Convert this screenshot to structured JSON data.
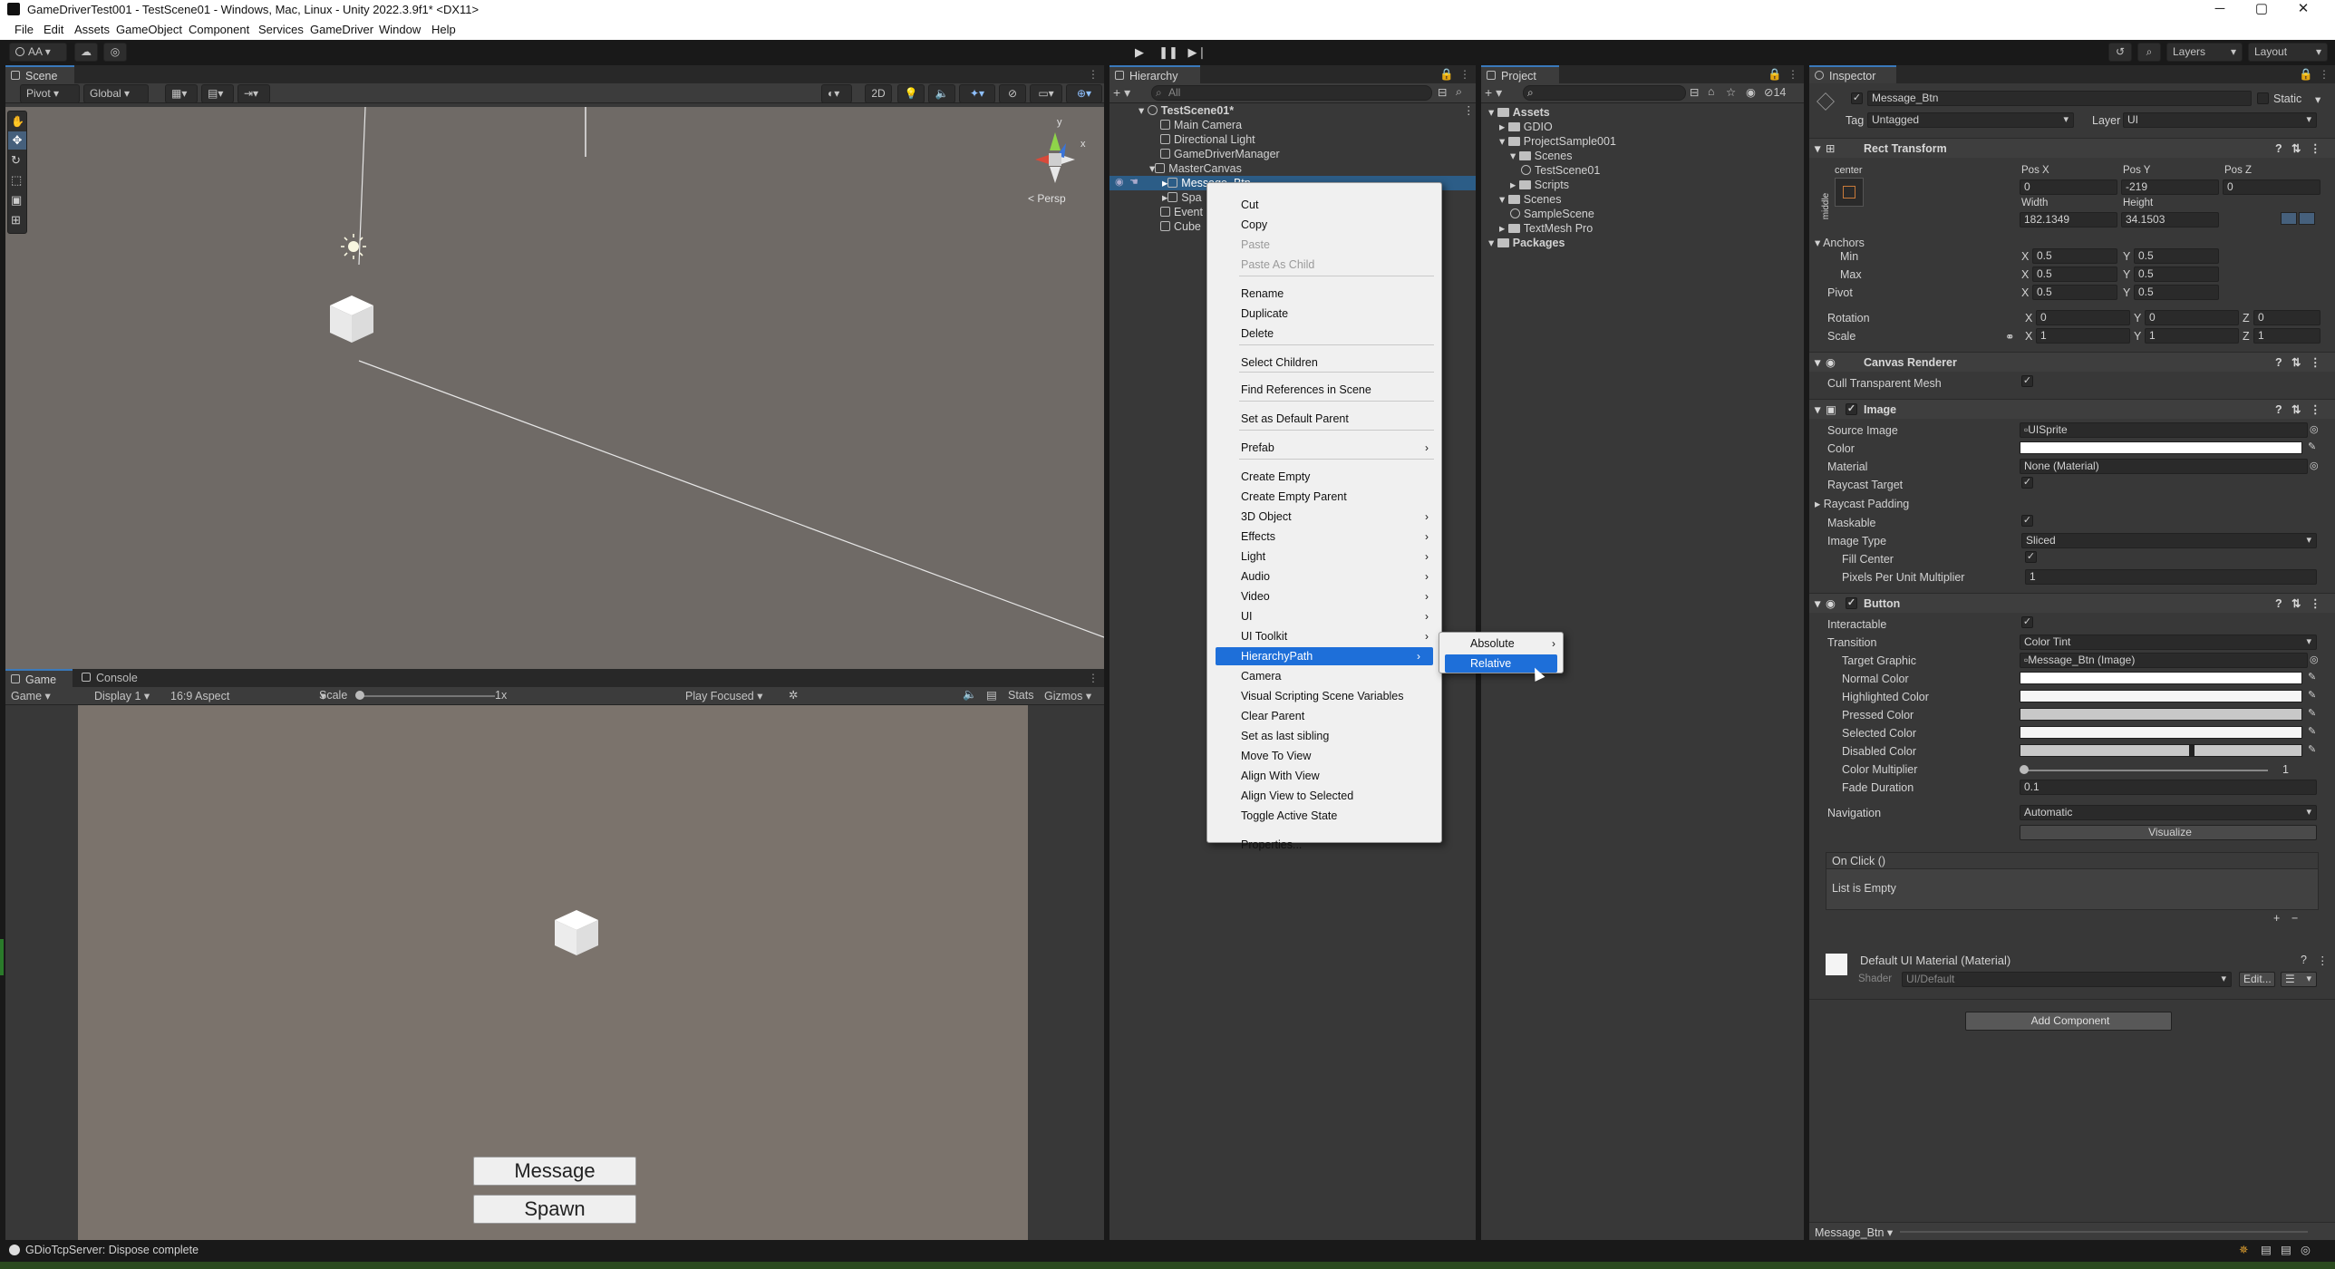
{
  "window": {
    "title": "GameDriverTest001 - TestScene01 - Windows, Mac, Linux - Unity 2022.3.9f1* <DX11>"
  },
  "menubar": {
    "items": [
      "File",
      "Edit",
      "Assets",
      "GameObject",
      "Component",
      "Services",
      "GameDriver",
      "Window",
      "Help"
    ]
  },
  "toolbar": {
    "account": "AA",
    "layers": "Layers",
    "layout": "Layout"
  },
  "scene": {
    "tab": "Scene",
    "pivot": "Pivot",
    "global": "Global",
    "mode_2d": "2D",
    "persp": "< Persp",
    "gizmo_y": "y",
    "gizmo_x": "x"
  },
  "game": {
    "tab_game": "Game",
    "tab_console": "Console",
    "display_mode": "Game",
    "display": "Display 1",
    "aspect": "16:9 Aspect",
    "scale_label": "Scale",
    "scale_value": "1x",
    "play_focused": "Play Focused",
    "stats": "Stats",
    "gizmos": "Gizmos",
    "buttons": [
      "Message",
      "Spawn"
    ]
  },
  "hierarchy": {
    "tab": "Hierarchy",
    "search_placeholder": "All",
    "scene_root": "TestScene01*",
    "items": [
      "Main Camera",
      "Directional Light",
      "GameDriverManager",
      "MasterCanvas",
      "Message_Btn",
      "Spa",
      "Event",
      "Cube"
    ]
  },
  "context_menu": {
    "items": [
      {
        "label": "Cut",
        "disabled": false
      },
      {
        "label": "Copy",
        "disabled": false
      },
      {
        "label": "Paste",
        "disabled": true
      },
      {
        "label": "Paste As Child",
        "disabled": true
      },
      {
        "label": "Rename",
        "disabled": false
      },
      {
        "label": "Duplicate",
        "disabled": false
      },
      {
        "label": "Delete",
        "disabled": false
      },
      {
        "label": "Select Children",
        "disabled": false
      },
      {
        "label": "Find References in Scene",
        "disabled": false
      },
      {
        "label": "Set as Default Parent",
        "disabled": false
      },
      {
        "label": "Prefab",
        "disabled": false,
        "submenu": true
      },
      {
        "label": "Create Empty",
        "disabled": false
      },
      {
        "label": "Create Empty Parent",
        "disabled": false
      },
      {
        "label": "3D Object",
        "disabled": false,
        "submenu": true
      },
      {
        "label": "Effects",
        "disabled": false,
        "submenu": true
      },
      {
        "label": "Light",
        "disabled": false,
        "submenu": true
      },
      {
        "label": "Audio",
        "disabled": false,
        "submenu": true
      },
      {
        "label": "Video",
        "disabled": false,
        "submenu": true
      },
      {
        "label": "UI",
        "disabled": false,
        "submenu": true
      },
      {
        "label": "UI Toolkit",
        "disabled": false,
        "submenu": true
      },
      {
        "label": "HierarchyPath",
        "disabled": false,
        "submenu": true,
        "selected": true
      },
      {
        "label": "Camera",
        "disabled": false
      },
      {
        "label": "Visual Scripting Scene Variables",
        "disabled": false
      },
      {
        "label": "Clear Parent",
        "disabled": false
      },
      {
        "label": "Set as last sibling",
        "disabled": false
      },
      {
        "label": "Move To View",
        "disabled": false
      },
      {
        "label": "Align With View",
        "disabled": false
      },
      {
        "label": "Align View to Selected",
        "disabled": false
      },
      {
        "label": "Toggle Active State",
        "disabled": false
      },
      {
        "label": "Properties...",
        "disabled": false
      }
    ],
    "submenu": [
      {
        "label": "Absolute",
        "submenu": true
      },
      {
        "label": "Relative",
        "selected": true
      }
    ]
  },
  "project": {
    "tab": "Project",
    "hidden_count": "14",
    "tree": [
      {
        "label": "Assets",
        "level": 0
      },
      {
        "label": "GDIO",
        "level": 1
      },
      {
        "label": "ProjectSample001",
        "level": 1
      },
      {
        "label": "Scenes",
        "level": 2
      },
      {
        "label": "TestScene01",
        "level": 3
      },
      {
        "label": "Scripts",
        "level": 2
      },
      {
        "label": "Scenes",
        "level": 1
      },
      {
        "label": "SampleScene",
        "level": 2
      },
      {
        "label": "TextMesh Pro",
        "level": 1
      },
      {
        "label": "Packages",
        "level": 0
      }
    ]
  },
  "inspector": {
    "tab": "Inspector",
    "object_name": "Message_Btn",
    "static": "Static",
    "tag_label": "Tag",
    "tag": "Untagged",
    "layer_label": "Layer",
    "layer": "UI",
    "rect_transform": {
      "title": "Rect Transform",
      "anchor_h": "center",
      "anchor_v": "middle",
      "posx_label": "Pos X",
      "posy_label": "Pos Y",
      "posz_label": "Pos Z",
      "posx": "0",
      "posy": "-219",
      "posz": "0",
      "width_label": "Width",
      "height_label": "Height",
      "width": "182.1349",
      "height": "34.1503",
      "anchors": "Anchors",
      "min": "Min",
      "max": "Max",
      "min_x": "0.5",
      "min_y": "0.5",
      "max_x": "0.5",
      "max_y": "0.5",
      "pivot": "Pivot",
      "pivot_x": "0.5",
      "pivot_y": "0.5",
      "rotation": "Rotation",
      "rot_x": "0",
      "rot_y": "0",
      "rot_z": "0",
      "scale": "Scale",
      "scale_x": "1",
      "scale_y": "1",
      "scale_z": "1",
      "x": "X",
      "y": "Y",
      "z": "Z"
    },
    "canvas_renderer": {
      "title": "Canvas Renderer",
      "cull": "Cull Transparent Mesh"
    },
    "image": {
      "title": "Image",
      "source_image_label": "Source Image",
      "source_image": "UISprite",
      "color_label": "Color",
      "material_label": "Material",
      "material": "None (Material)",
      "raycast_target": "Raycast Target",
      "raycast_padding": "Raycast Padding",
      "maskable": "Maskable",
      "image_type_label": "Image Type",
      "image_type": "Sliced",
      "fill_center": "Fill Center",
      "ppu_label": "Pixels Per Unit Multiplier",
      "ppu": "1"
    },
    "button": {
      "title": "Button",
      "interactable": "Interactable",
      "transition_label": "Transition",
      "transition": "Color Tint",
      "target_graphic_label": "Target Graphic",
      "target_graphic": "Message_Btn (Image)",
      "normal": "Normal Color",
      "highlighted": "Highlighted Color",
      "pressed": "Pressed Color",
      "selected": "Selected Color",
      "disabled": "Disabled Color",
      "multiplier_label": "Color Multiplier",
      "multiplier": "1",
      "fade_label": "Fade Duration",
      "fade": "0.1",
      "navigation_label": "Navigation",
      "navigation": "Automatic",
      "visualize": "Visualize",
      "onclick": "On Click ()",
      "list_empty": "List is Empty",
      "plus": "+",
      "minus": "−"
    },
    "material": {
      "title": "Default UI Material (Material)",
      "shader_label": "Shader",
      "shader": "UI/Default",
      "edit": "Edit..."
    },
    "add_component": "Add Component",
    "footer": "Message_Btn"
  },
  "status": {
    "message": "GDioTcpServer: Dispose complete"
  },
  "colors": {
    "accent": "#1e6fd9",
    "panel": "#383838",
    "scene_bg": "#6f6a66"
  }
}
